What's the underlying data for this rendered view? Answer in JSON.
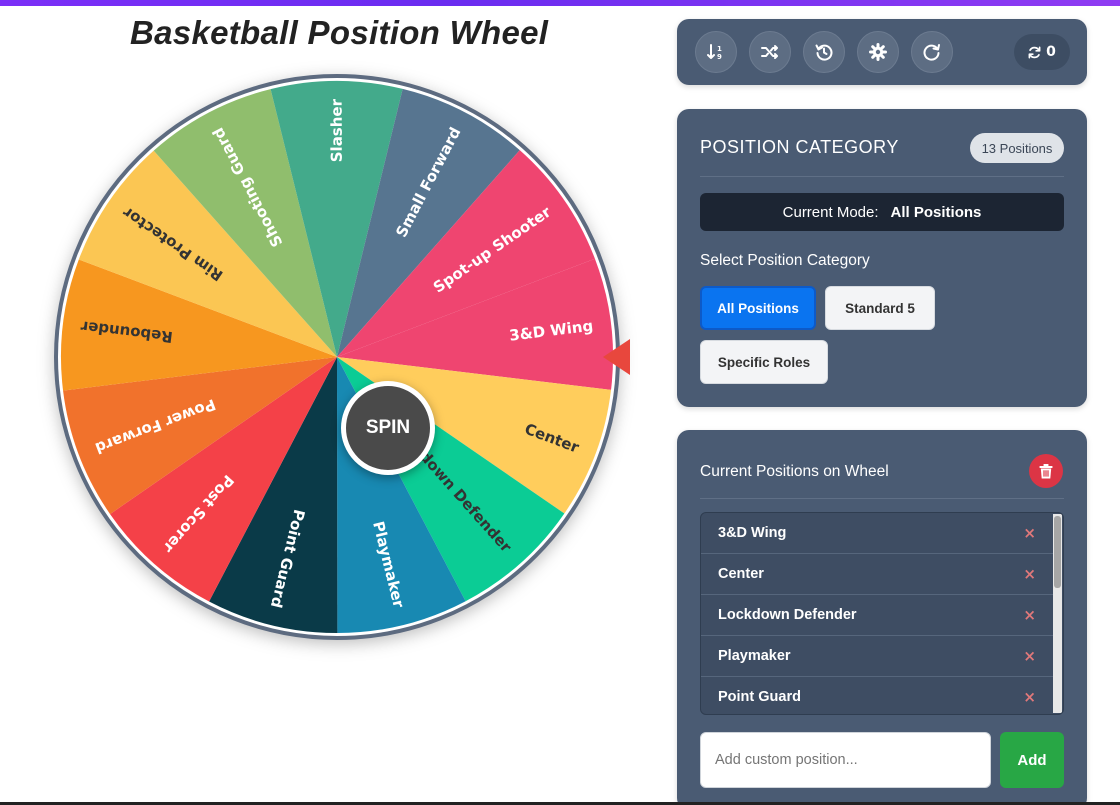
{
  "page": {
    "title": "Basketball Position Wheel"
  },
  "wheel": {
    "spin_label": "SPIN",
    "segments": [
      {
        "label": "3&D Wing",
        "color": "#ef4570",
        "text_color": "#ffffff"
      },
      {
        "label": "Center",
        "color": "#ffcd5c",
        "text_color": "#333333"
      },
      {
        "label": "Lockdown Defender",
        "color": "#0bcc95",
        "text_color": "#333333"
      },
      {
        "label": "Playmaker",
        "color": "#1889b2",
        "text_color": "#ffffff"
      },
      {
        "label": "Point Guard",
        "color": "#0a3a48",
        "text_color": "#ffffff"
      },
      {
        "label": "Post Scorer",
        "color": "#f44148",
        "text_color": "#ffffff"
      },
      {
        "label": "Power Forward",
        "color": "#f1722c",
        "text_color": "#ffffff"
      },
      {
        "label": "Rebounder",
        "color": "#f7971f",
        "text_color": "#333333"
      },
      {
        "label": "Rim Protector",
        "color": "#fbc653",
        "text_color": "#333333"
      },
      {
        "label": "Shooting Guard",
        "color": "#90be6d",
        "text_color": "#ffffff"
      },
      {
        "label": "Slasher",
        "color": "#43aa8b",
        "text_color": "#ffffff"
      },
      {
        "label": "Small Forward",
        "color": "#577590",
        "text_color": "#ffffff"
      },
      {
        "label": "Spot-up Shooter",
        "color": "#ef4570",
        "text_color": "#ffffff"
      }
    ]
  },
  "toolbar": {
    "buttons": [
      {
        "name": "sort-button",
        "icon": "sort-numeric-icon"
      },
      {
        "name": "shuffle-button",
        "icon": "shuffle-icon"
      },
      {
        "name": "history-button",
        "icon": "history-icon"
      },
      {
        "name": "settings-button",
        "icon": "gear-icon"
      },
      {
        "name": "reset-button",
        "icon": "redo-icon"
      }
    ],
    "spin_count": "0"
  },
  "category": {
    "title": "POSITION CATEGORY",
    "count_badge": "13 Positions",
    "mode_label": "Current Mode:",
    "mode_value": "All Positions",
    "select_label": "Select Position Category",
    "options": [
      "All Positions",
      "Standard 5",
      "Specific Roles"
    ],
    "active_option": "All Positions"
  },
  "positions": {
    "title": "Current Positions on Wheel",
    "items": [
      "3&D Wing",
      "Center",
      "Lockdown Defender",
      "Playmaker",
      "Point Guard"
    ],
    "remove_glyph": "×",
    "input_placeholder": "Add custom position...",
    "add_label": "Add"
  },
  "colors": {
    "card_bg": "#4a5b73",
    "accent_blue": "#0a74f0",
    "add_green": "#28a745",
    "delete_red": "#dc3545",
    "pointer_red": "#e8473d"
  }
}
